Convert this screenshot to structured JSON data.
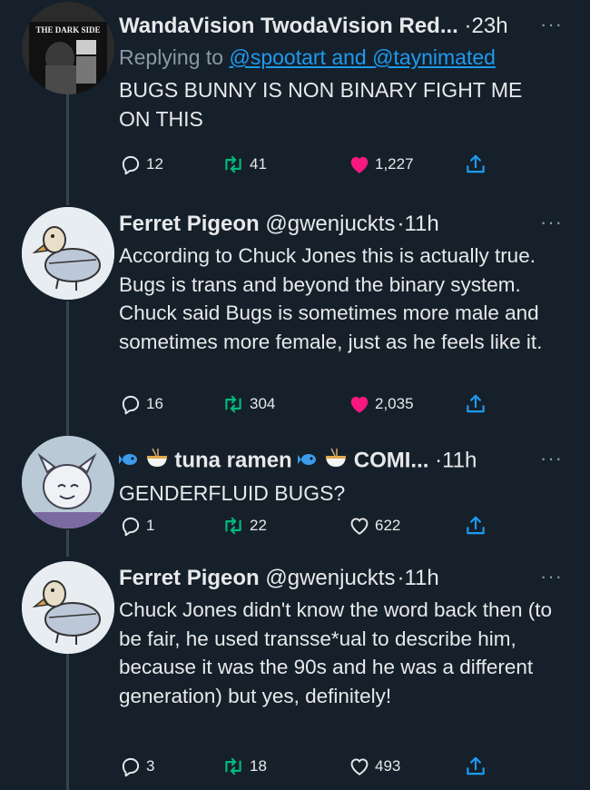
{
  "tweets": [
    {
      "name": "WandaVision TwodaVision Red...",
      "handle": "",
      "time": "23h",
      "reply_prefix": "Replying to",
      "reply_to": "@spootart and @taynimated",
      "text": "BUGS BUNNY IS NON BINARY FIGHT ME ON THIS",
      "replies": "12",
      "retweets": "41",
      "likes": "1,227",
      "liked": true,
      "avatar_text": "THE DARK SIDE"
    },
    {
      "name": "Ferret Pigeon",
      "handle": "@gwenjuckts",
      "time": "11h",
      "text": "According to Chuck Jones this is actually true. Bugs is trans and beyond the binary system. Chuck said Bugs is sometimes more male and sometimes more female, just as he feels like it.",
      "replies": "16",
      "retweets": "304",
      "likes": "2,035",
      "liked": true
    },
    {
      "name_a": "tuna ramen",
      "name_b": "COMI...",
      "time": "11h",
      "text": "GENDERFLUID BUGS?",
      "replies": "1",
      "retweets": "22",
      "likes": "622",
      "liked": false
    },
    {
      "name": "Ferret Pigeon",
      "handle": "@gwenjuckts",
      "time": "11h",
      "text": "Chuck Jones didn't know the word back then (to be fair, he used transse*ual to describe him, because it was the 90s and he was a different generation) but yes, definitely!",
      "replies": "3",
      "retweets": "18",
      "likes": "493",
      "liked": false
    }
  ],
  "ui": {
    "separator": "·",
    "more": "···"
  },
  "colors": {
    "background": "#15202b",
    "thread_line": "#38444d",
    "link": "#1d9bf0",
    "retweet": "#00ba7c",
    "like": "#f91880",
    "muted": "#8b98a5"
  }
}
